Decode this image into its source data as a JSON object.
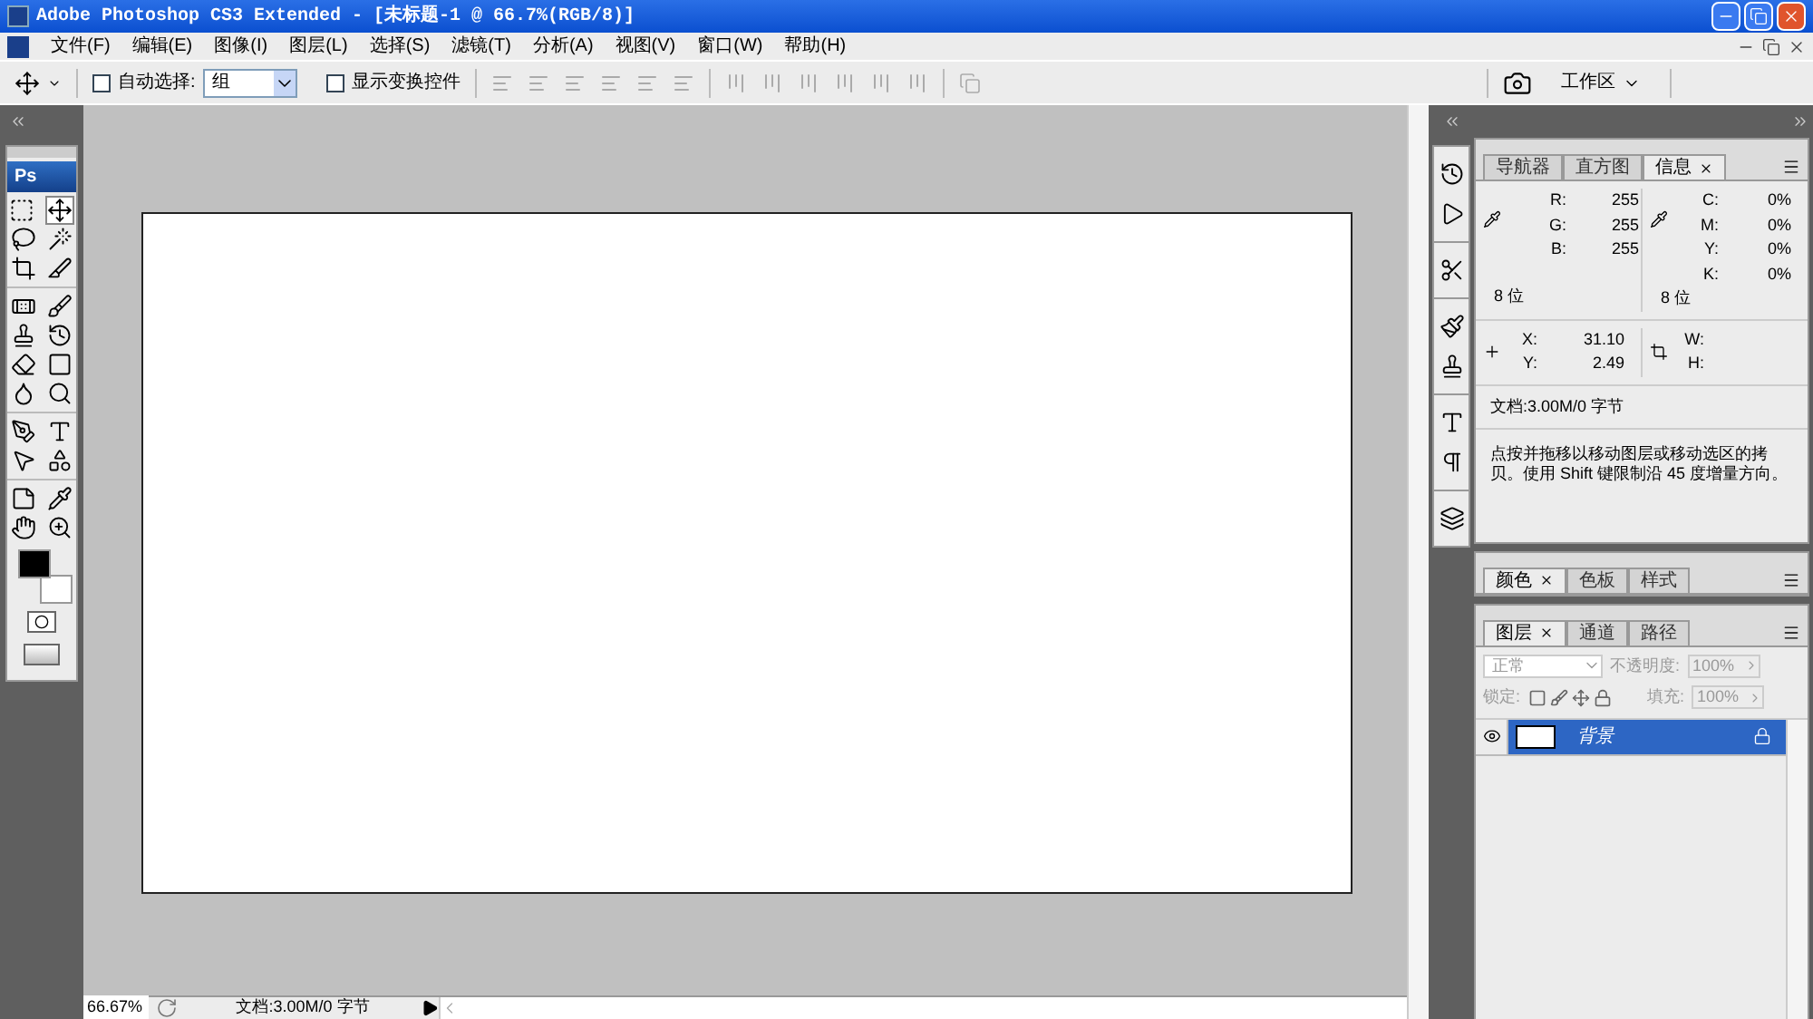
{
  "window": {
    "title": "Adobe Photoshop CS3 Extended - [未标题-1 @ 66.7%(RGB/8)]"
  },
  "menu": [
    "文件(F)",
    "编辑(E)",
    "图像(I)",
    "图层(L)",
    "选择(S)",
    "滤镜(T)",
    "分析(A)",
    "视图(V)",
    "窗口(W)",
    "帮助(H)"
  ],
  "options_bar": {
    "auto_select": {
      "label": "自动选择:",
      "checked": false,
      "value": "组"
    },
    "show_transform": {
      "label": "显示变换控件",
      "checked": false
    },
    "workspace": "工作区"
  },
  "toolbox": {
    "logo": "Ps"
  },
  "info_panel": {
    "tabs": [
      {
        "label": "导航器",
        "selected": false
      },
      {
        "label": "直方图",
        "selected": false
      },
      {
        "label": "信息",
        "selected": true
      }
    ],
    "rgb": [
      {
        "label": "R:",
        "value": "255"
      },
      {
        "label": "G:",
        "value": "255"
      },
      {
        "label": "B:",
        "value": "255"
      }
    ],
    "cmyk": [
      {
        "label": "C:",
        "value": "0%"
      },
      {
        "label": "M:",
        "value": "0%"
      },
      {
        "label": "Y:",
        "value": "0%"
      },
      {
        "label": "K:",
        "value": "0%"
      }
    ],
    "bits_left": "8 位",
    "bits_right": "8 位",
    "position": [
      {
        "label": "X:",
        "value": "31.10"
      },
      {
        "label": "Y:",
        "value": "2.49"
      }
    ],
    "size": [
      {
        "label": "W:"
      },
      {
        "label": "H:"
      }
    ],
    "document": "文档:3.00M/0 字节",
    "hint": "点按并拖移以移动图层或移动选区的拷贝。使用 Shift 键限制沿 45 度增量方向。"
  },
  "color_panel": {
    "tabs": [
      {
        "label": "颜色",
        "selected": true
      },
      {
        "label": "色板",
        "selected": false
      },
      {
        "label": "样式",
        "selected": false
      }
    ]
  },
  "layers_panel": {
    "tabs": [
      {
        "label": "图层",
        "selected": true
      },
      {
        "label": "通道",
        "selected": false
      },
      {
        "label": "路径",
        "selected": false
      }
    ],
    "blend_mode": "正常",
    "opacity_label": "不透明度:",
    "opacity": "100%",
    "lock_label": "锁定:",
    "fill_label": "填充:",
    "fill": "100%",
    "layers": [
      {
        "name": "背景",
        "visible": true,
        "selected": true,
        "locked": true
      }
    ]
  },
  "status_bar": {
    "zoom": "66.67%",
    "document": "文档:3.00M/0 字节"
  }
}
